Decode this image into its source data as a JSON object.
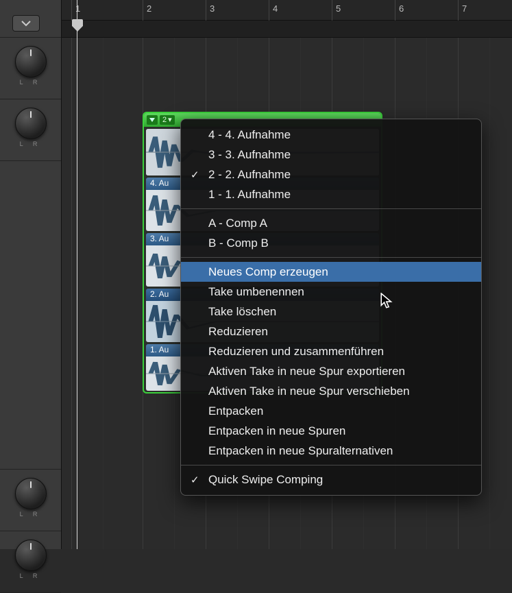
{
  "ruler": {
    "marks": [
      "1",
      "2",
      "3",
      "4",
      "5",
      "6",
      "7"
    ]
  },
  "lr_label": "L   R",
  "take_folder": {
    "selected_index": "2",
    "takes": [
      {
        "label": "4. Au"
      },
      {
        "label": "3. Au"
      },
      {
        "label": "2. Au"
      },
      {
        "label": "1. Au"
      }
    ]
  },
  "menu": {
    "section_takes": [
      {
        "label": "4 - 4. Aufnahme",
        "checked": false
      },
      {
        "label": "3 - 3. Aufnahme",
        "checked": false
      },
      {
        "label": "2 - 2. Aufnahme",
        "checked": true
      },
      {
        "label": "1 - 1. Aufnahme",
        "checked": false
      }
    ],
    "section_comps": [
      {
        "label": "A - Comp A"
      },
      {
        "label": "B - Comp B"
      }
    ],
    "section_actions": [
      {
        "label": "Neues Comp erzeugen",
        "highlight": true
      },
      {
        "label": "Take umbenennen"
      },
      {
        "label": "Take löschen"
      },
      {
        "label": "Reduzieren"
      },
      {
        "label": "Reduzieren und zusammenführen"
      },
      {
        "label": "Aktiven Take in neue Spur exportieren"
      },
      {
        "label": "Aktiven Take in neue Spur verschieben"
      },
      {
        "label": "Entpacken"
      },
      {
        "label": "Entpacken in neue Spuren"
      },
      {
        "label": "Entpacken in neue Spuralternativen"
      }
    ],
    "section_toggle": [
      {
        "label": "Quick Swipe Comping",
        "checked": true
      }
    ]
  }
}
